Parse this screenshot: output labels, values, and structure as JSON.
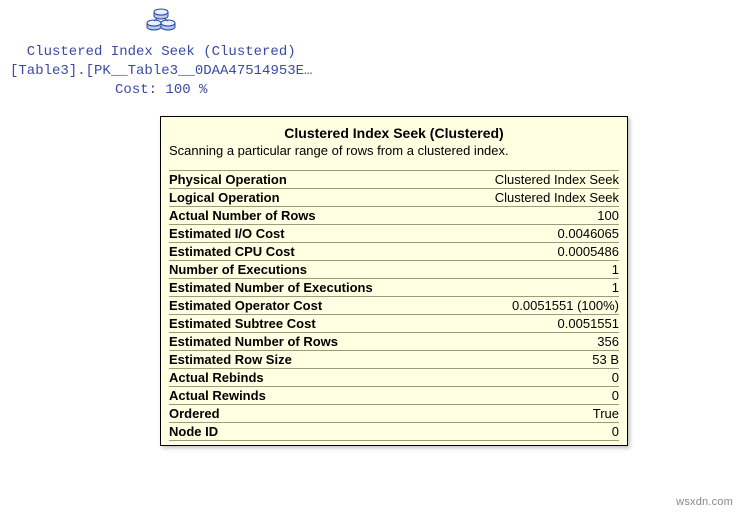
{
  "planNode": {
    "line1": "Clustered Index Seek (Clustered)",
    "line2": "[Table3].[PK__Table3__0DAA47514953E…",
    "line3": "Cost: 100 %"
  },
  "tooltip": {
    "title": "Clustered Index Seek (Clustered)",
    "description": "Scanning a particular range of rows from a clustered index.",
    "rows": [
      {
        "label": "Physical Operation",
        "value": "Clustered Index Seek"
      },
      {
        "label": "Logical Operation",
        "value": "Clustered Index Seek"
      },
      {
        "label": "Actual Number of Rows",
        "value": "100"
      },
      {
        "label": "Estimated I/O Cost",
        "value": "0.0046065"
      },
      {
        "label": "Estimated CPU Cost",
        "value": "0.0005486"
      },
      {
        "label": "Number of Executions",
        "value": "1"
      },
      {
        "label": "Estimated Number of Executions",
        "value": "1"
      },
      {
        "label": "Estimated Operator Cost",
        "value": "0.0051551 (100%)"
      },
      {
        "label": "Estimated Subtree Cost",
        "value": "0.0051551"
      },
      {
        "label": "Estimated Number of Rows",
        "value": "356"
      },
      {
        "label": "Estimated Row Size",
        "value": "53 B"
      },
      {
        "label": "Actual Rebinds",
        "value": "0"
      },
      {
        "label": "Actual Rewinds",
        "value": "0"
      },
      {
        "label": "Ordered",
        "value": "True"
      },
      {
        "label": "Node ID",
        "value": "0"
      }
    ]
  },
  "watermark": "wsxdn.com"
}
